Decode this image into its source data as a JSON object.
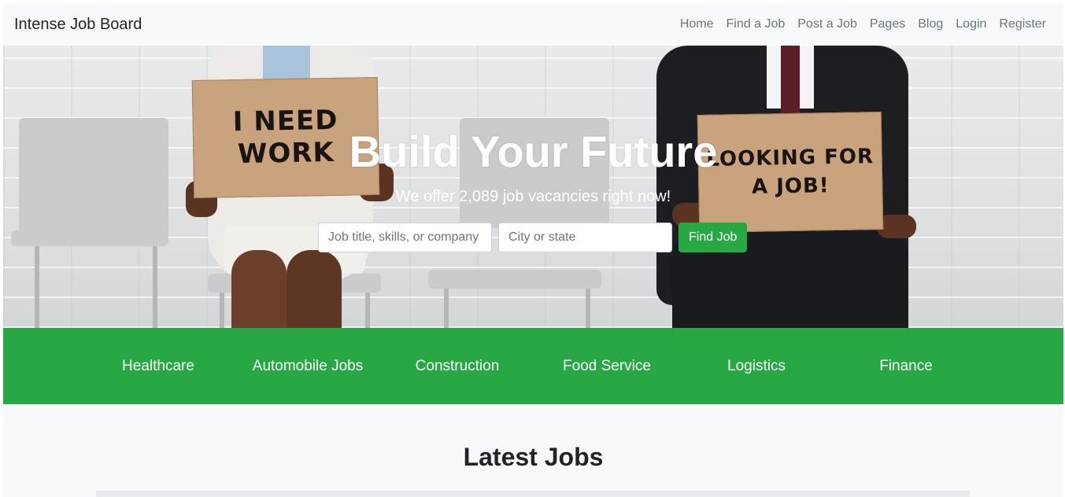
{
  "navbar": {
    "brand": "Intense Job Board",
    "links": [
      "Home",
      "Find a Job",
      "Post a Job",
      "Pages",
      "Blog",
      "Login",
      "Register"
    ]
  },
  "hero": {
    "title": "Build Your Future",
    "subtitle": "We offer 2,089 job vacancies right now!",
    "sign_left": "I NEED WORK",
    "sign_right": "LOOKING FOR A JOB!",
    "search": {
      "keyword_placeholder": "Job title, skills, or company",
      "location_placeholder": "City or state",
      "button_label": "Find Job"
    }
  },
  "categories": [
    "Healthcare",
    "Automobile Jobs",
    "Construction",
    "Food Service",
    "Logistics",
    "Finance"
  ],
  "latest": {
    "title": "Latest Jobs"
  },
  "colors": {
    "accent": "#28a745",
    "navbar_bg": "#f8f9fa",
    "nav_link": "#6c757d"
  }
}
